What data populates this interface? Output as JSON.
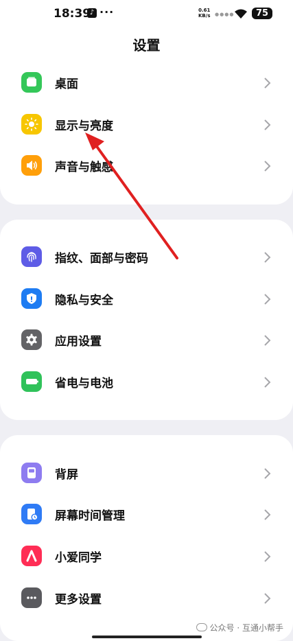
{
  "status_bar": {
    "time": "18:39",
    "app_badge": "♪",
    "dots": "···",
    "net_speed_value": "0.61",
    "net_speed_unit": "KB/s",
    "signal": "●●●●",
    "battery": "75"
  },
  "header": {
    "title": "设置"
  },
  "groups": [
    {
      "items": [
        {
          "label": "桌面",
          "icon": "desktop-icon",
          "color": "#34c759"
        },
        {
          "label": "显示与亮度",
          "icon": "sun-icon",
          "color": "#f7c600"
        },
        {
          "label": "声音与触感",
          "icon": "speaker-icon",
          "color": "#ff9f0a"
        }
      ]
    },
    {
      "items": [
        {
          "label": "指纹、面部与密码",
          "icon": "fingerprint-icon",
          "color": "#5e5ce6"
        },
        {
          "label": "隐私与安全",
          "icon": "shield-icon",
          "color": "#1e7cf2"
        },
        {
          "label": "应用设置",
          "icon": "gear-icon",
          "color": "#636366"
        },
        {
          "label": "省电与电池",
          "icon": "battery-icon",
          "color": "#30c25a"
        }
      ]
    },
    {
      "items": [
        {
          "label": "背屏",
          "icon": "back-screen-icon",
          "color": "#8e7cf0"
        },
        {
          "label": "屏幕时间管理",
          "icon": "screen-time-icon",
          "color": "#2f7bf5"
        },
        {
          "label": "小爱同学",
          "icon": "xiaoai-icon",
          "color": "#ff2d55"
        },
        {
          "label": "更多设置",
          "icon": "more-icon",
          "color": "#5a5a5e"
        }
      ]
    }
  ],
  "annotation": {
    "color": "#e02020"
  },
  "watermark": {
    "text": "公众号 · 互通小帮手"
  }
}
